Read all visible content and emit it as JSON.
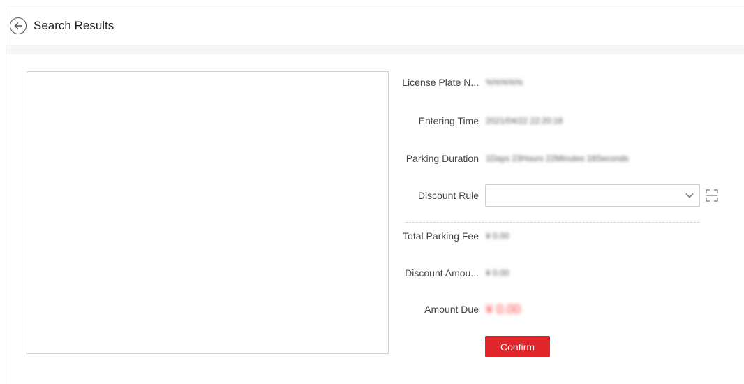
{
  "header": {
    "title": "Search Results",
    "back_icon": "back-arrow-circle-icon"
  },
  "details": {
    "license_plate": {
      "label": "License Plate N...",
      "value": "%%%%%"
    },
    "entering_time": {
      "label": "Entering Time",
      "value": "2021/04/22 22:20:18"
    },
    "parking_duration": {
      "label": "Parking Duration",
      "value": "1Days 23Hours 22Minutes 18Seconds"
    },
    "discount_rule": {
      "label": "Discount Rule",
      "value": ""
    },
    "total_parking_fee": {
      "label": "Total Parking Fee",
      "value": "¥ 0.00"
    },
    "discount_amount": {
      "label": "Discount Amou...",
      "value": "¥ 0.00"
    },
    "amount_due": {
      "label": "Amount Due",
      "value": "¥ 0.00"
    }
  },
  "confirm_label": "Confirm",
  "colors": {
    "accent": "#e0262a",
    "amount_due": "#ff3a3a"
  }
}
